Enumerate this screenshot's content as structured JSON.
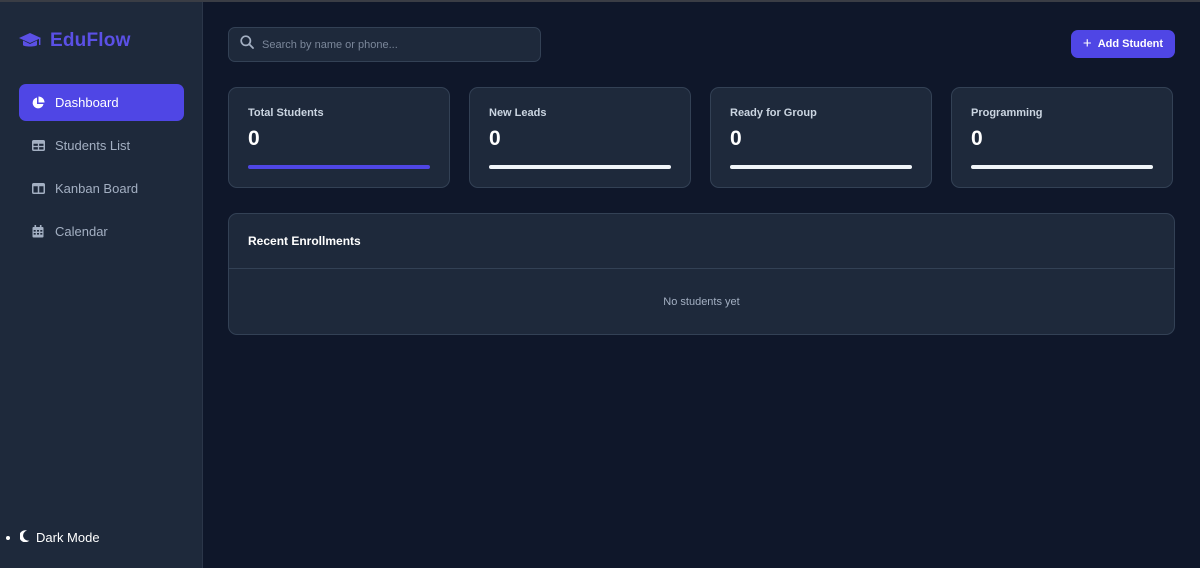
{
  "brand": {
    "name": "EduFlow",
    "icon": "graduation-cap-icon",
    "color": "#5b50e6"
  },
  "sidebar": {
    "items": [
      {
        "label": "Dashboard",
        "icon": "pie-chart-icon",
        "active": true
      },
      {
        "label": "Students List",
        "icon": "table-icon",
        "active": false
      },
      {
        "label": "Kanban Board",
        "icon": "columns-icon",
        "active": false
      },
      {
        "label": "Calendar",
        "icon": "calendar-icon",
        "active": false
      }
    ],
    "dark_mode_label": "Dark Mode"
  },
  "search": {
    "placeholder": "Search by name or phone...",
    "value": ""
  },
  "actions": {
    "add_student_label": "Add Student"
  },
  "stats": [
    {
      "title": "Total Students",
      "value": "0",
      "bar_color": "#4f46e5"
    },
    {
      "title": "New Leads",
      "value": "0",
      "bar_color": "#f1f5f9"
    },
    {
      "title": "Ready for Group",
      "value": "0",
      "bar_color": "#f1f5f9"
    },
    {
      "title": "Programming",
      "value": "0",
      "bar_color": "#f1f5f9"
    }
  ],
  "recent": {
    "title": "Recent Enrollments",
    "empty_text": "No students yet"
  },
  "colors": {
    "accent": "#4f46e5",
    "background": "#0f172a",
    "surface": "#1e293b"
  }
}
